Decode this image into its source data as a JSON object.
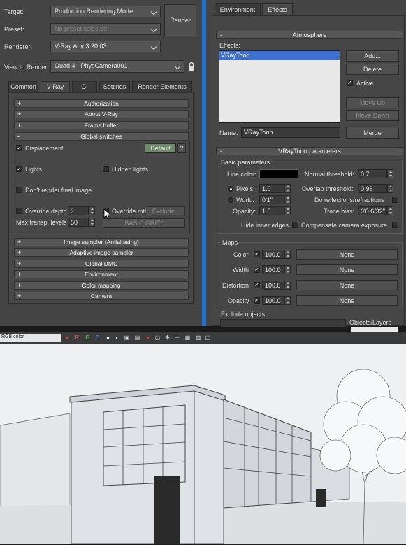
{
  "render_setup": {
    "target_label": "Target:",
    "target_value": "Production Rendering Mode",
    "preset_label": "Preset:",
    "preset_value": "No preset selected",
    "renderer_label": "Renderer:",
    "renderer_value": "V-Ray Adv 3.20.03",
    "view_label": "View to Render:",
    "view_value": "Quad 4 - PhysCamera001",
    "render_button": "Render",
    "tabs": [
      "Common",
      "V-Ray",
      "GI",
      "Settings",
      "Render Elements"
    ],
    "rollouts_top": [
      "Authorization",
      "About V-Ray",
      "Frame buffer",
      "Global switches"
    ],
    "displacement": "Displacement",
    "default_button": "Default",
    "help": "?",
    "lights": "Lights",
    "hidden_lights": "Hidden lights",
    "dont_render": "Don't render final image",
    "override_depth": "Override depth",
    "override_depth_value": "2",
    "override_mtl": "Override mtl",
    "exclude_button": "Exclude...",
    "max_transp": "Max transp. levels",
    "max_transp_value": "50",
    "basic_grey": "BASIC GREY",
    "rollouts_bottom": [
      "Image sampler (Antialiasing)",
      "Adaptive image sampler",
      "Global DMC",
      "Environment",
      "Color mapping",
      "Camera"
    ]
  },
  "effects_panel": {
    "tabs": [
      "Environment",
      "Effects"
    ],
    "atmosphere_title": "Atmosphere",
    "effects_label": "Effects:",
    "effects_list": [
      "VRayToon"
    ],
    "add_button": "Add...",
    "delete_button": "Delete",
    "active_label": "Active",
    "move_up": "Move Up",
    "move_down": "Move Down",
    "name_label": "Name:",
    "name_value": "VRayToon",
    "merge_button": "Merge",
    "toon_title": "VRayToon parameters",
    "basic_params": "Basic parameters",
    "line_color": "Line color:",
    "line_color_hex": "#000000",
    "normal_threshold": "Normal threshold:",
    "normal_threshold_value": "0.7",
    "pixels": "Pixels:",
    "pixels_value": "1.0",
    "overlap_threshold": "Overlap threshold:",
    "overlap_threshold_value": "0.95",
    "world": "World:",
    "world_value": "0'1\"",
    "do_reflections": "Do reflections/refractions",
    "opacity": "Opacity:",
    "opacity_value": "1.0",
    "trace_bias": "Trace bias:",
    "trace_bias_value": "0'0 6/32\"",
    "hide_inner": "Hide inner edges",
    "compensate": "Compensate camera exposure",
    "maps_title": "Maps",
    "maps": [
      {
        "label": "Color",
        "value": "100.0",
        "map": "None"
      },
      {
        "label": "Width",
        "value": "100.0",
        "map": "None"
      },
      {
        "label": "Distortion",
        "value": "100.0",
        "map": "None"
      },
      {
        "label": "Opacity",
        "value": "100.0",
        "map": "None"
      }
    ],
    "exclude_objects": "Exclude objects",
    "objects_layers": "Objects/Layers"
  },
  "toolbar": {
    "channel": "RGB color",
    "letters": [
      "R",
      "G",
      "B"
    ]
  }
}
